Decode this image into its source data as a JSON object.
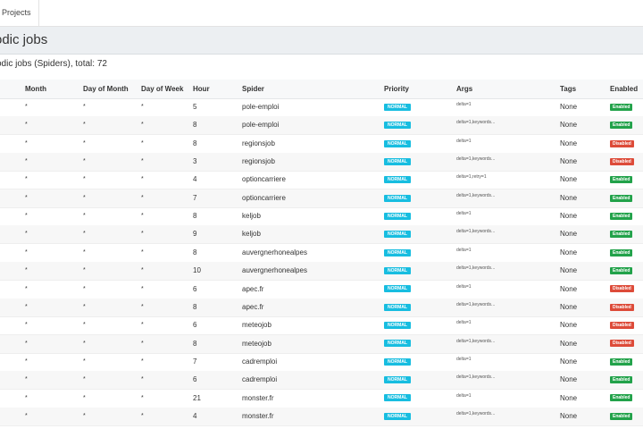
{
  "nav": {
    "projects_tab": "Projects"
  },
  "header": {
    "title": "odic jobs"
  },
  "subtitle": "odic jobs (Spiders), total: 72",
  "table": {
    "columns": {
      "month": "Month",
      "day_of_month": "Day of Month",
      "day_of_week": "Day of Week",
      "hour": "Hour",
      "spider": "Spider",
      "priority": "Priority",
      "args": "Args",
      "tags": "Tags",
      "enabled": "Enabled"
    },
    "rows": [
      {
        "month": "*",
        "dom": "*",
        "dow": "*",
        "hour": "5",
        "spider": "pole-emploi",
        "priority": "NORMAL",
        "args": "delta=1",
        "tags": "None",
        "enabled": "Enabled"
      },
      {
        "month": "*",
        "dom": "*",
        "dow": "*",
        "hour": "8",
        "spider": "pole-emploi",
        "priority": "NORMAL",
        "args": "delta=1,keywords...",
        "tags": "None",
        "enabled": "Enabled"
      },
      {
        "month": "*",
        "dom": "*",
        "dow": "*",
        "hour": "8",
        "spider": "regionsjob",
        "priority": "NORMAL",
        "args": "delta=1",
        "tags": "None",
        "enabled": "Disabled"
      },
      {
        "month": "*",
        "dom": "*",
        "dow": "*",
        "hour": "3",
        "spider": "regionsjob",
        "priority": "NORMAL",
        "args": "delta=1,keywords...",
        "tags": "None",
        "enabled": "Disabled"
      },
      {
        "month": "*",
        "dom": "*",
        "dow": "*",
        "hour": "4",
        "spider": "optioncarriere",
        "priority": "NORMAL",
        "args": "delta=1,retry=1",
        "tags": "None",
        "enabled": "Enabled"
      },
      {
        "month": "*",
        "dom": "*",
        "dow": "*",
        "hour": "7",
        "spider": "optioncarriere",
        "priority": "NORMAL",
        "args": "delta=1,keywords...",
        "tags": "None",
        "enabled": "Enabled"
      },
      {
        "month": "*",
        "dom": "*",
        "dow": "*",
        "hour": "8",
        "spider": "keljob",
        "priority": "NORMAL",
        "args": "delta=1",
        "tags": "None",
        "enabled": "Enabled"
      },
      {
        "month": "*",
        "dom": "*",
        "dow": "*",
        "hour": "9",
        "spider": "keljob",
        "priority": "NORMAL",
        "args": "delta=1,keywords...",
        "tags": "None",
        "enabled": "Enabled"
      },
      {
        "month": "*",
        "dom": "*",
        "dow": "*",
        "hour": "8",
        "spider": "auvergnerhonealpes",
        "priority": "NORMAL",
        "args": "delta=1",
        "tags": "None",
        "enabled": "Enabled"
      },
      {
        "month": "*",
        "dom": "*",
        "dow": "*",
        "hour": "10",
        "spider": "auvergnerhonealpes",
        "priority": "NORMAL",
        "args": "delta=1,keywords...",
        "tags": "None",
        "enabled": "Enabled"
      },
      {
        "month": "*",
        "dom": "*",
        "dow": "*",
        "hour": "6",
        "spider": "apec.fr",
        "priority": "NORMAL",
        "args": "delta=1",
        "tags": "None",
        "enabled": "Disabled"
      },
      {
        "month": "*",
        "dom": "*",
        "dow": "*",
        "hour": "8",
        "spider": "apec.fr",
        "priority": "NORMAL",
        "args": "delta=1,keywords...",
        "tags": "None",
        "enabled": "Disabled"
      },
      {
        "month": "*",
        "dom": "*",
        "dow": "*",
        "hour": "6",
        "spider": "meteojob",
        "priority": "NORMAL",
        "args": "delta=1",
        "tags": "None",
        "enabled": "Disabled"
      },
      {
        "month": "*",
        "dom": "*",
        "dow": "*",
        "hour": "8",
        "spider": "meteojob",
        "priority": "NORMAL",
        "args": "delta=1,keywords...",
        "tags": "None",
        "enabled": "Disabled"
      },
      {
        "month": "*",
        "dom": "*",
        "dow": "*",
        "hour": "7",
        "spider": "cadremploi",
        "priority": "NORMAL",
        "args": "delta=1",
        "tags": "None",
        "enabled": "Enabled"
      },
      {
        "month": "*",
        "dom": "*",
        "dow": "*",
        "hour": "6",
        "spider": "cadremploi",
        "priority": "NORMAL",
        "args": "delta=1,keywords...",
        "tags": "None",
        "enabled": "Enabled"
      },
      {
        "month": "*",
        "dom": "*",
        "dow": "*",
        "hour": "21",
        "spider": "monster.fr",
        "priority": "NORMAL",
        "args": "delta=1",
        "tags": "None",
        "enabled": "Enabled"
      },
      {
        "month": "*",
        "dom": "*",
        "dow": "*",
        "hour": "4",
        "spider": "monster.fr",
        "priority": "NORMAL",
        "args": "delta=1,keywords...",
        "tags": "None",
        "enabled": "Enabled"
      }
    ]
  },
  "colors": {
    "priority_badge": "#17bde0",
    "enabled_badge": "#22a24a",
    "disabled_badge": "#dd4b39",
    "header_bg": "#eceff2"
  }
}
